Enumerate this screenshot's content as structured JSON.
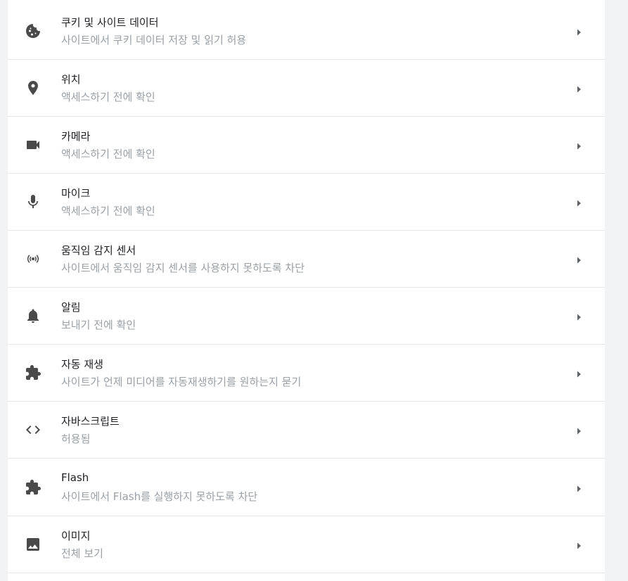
{
  "settings": {
    "items": [
      {
        "icon": "cookie-icon",
        "title": "쿠키 및 사이트 데이터",
        "subtitle": "사이트에서 쿠키 데이터 저장 및 읽기 허용"
      },
      {
        "icon": "location-pin-icon",
        "title": "위치",
        "subtitle": "액세스하기 전에 확인"
      },
      {
        "icon": "camera-icon",
        "title": "카메라",
        "subtitle": "액세스하기 전에 확인"
      },
      {
        "icon": "microphone-icon",
        "title": "마이크",
        "subtitle": "액세스하기 전에 확인"
      },
      {
        "icon": "motion-sensor-icon",
        "title": "움직임 감지 센서",
        "subtitle": "사이트에서 움직임 감지 센서를 사용하지 못하도록 차단"
      },
      {
        "icon": "bell-icon",
        "title": "알림",
        "subtitle": "보내기 전에 확인"
      },
      {
        "icon": "puzzle-icon",
        "title": "자동 재생",
        "subtitle": "사이트가 언제 미디어를 자동재생하기를 원하는지 묻기"
      },
      {
        "icon": "code-brackets-icon",
        "title": "자바스크립트",
        "subtitle": "허용됨"
      },
      {
        "icon": "puzzle-icon",
        "title": "Flash",
        "subtitle": "사이트에서 Flash를 실행하지 못하도록 차단"
      },
      {
        "icon": "image-icon",
        "title": "이미지",
        "subtitle": "전체 보기"
      }
    ]
  }
}
